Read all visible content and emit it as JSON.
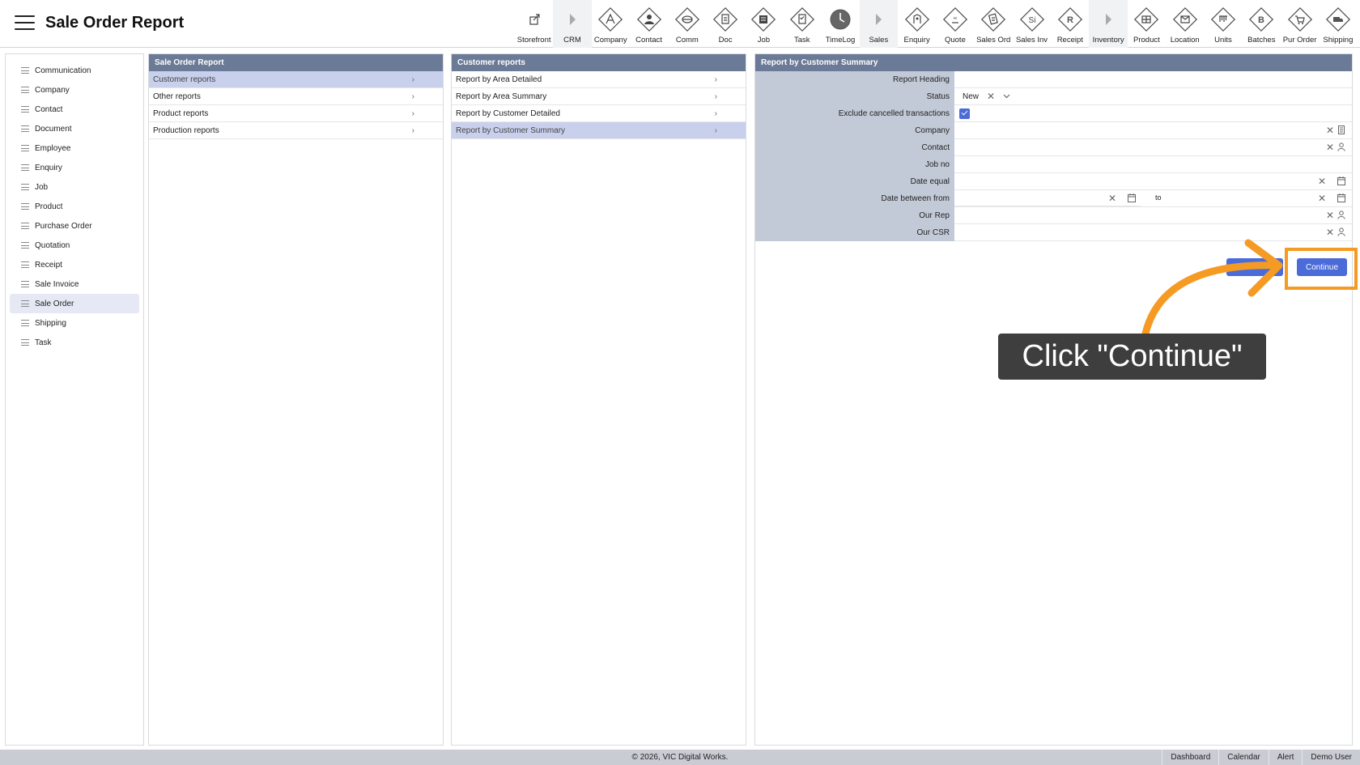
{
  "header": {
    "title": "Sale Order Report"
  },
  "toolbar": [
    {
      "label": "Storefront",
      "icon": "external-link-icon"
    },
    {
      "label": "CRM",
      "icon": "triangle-right-icon"
    },
    {
      "label": "Company",
      "icon": "company-icon"
    },
    {
      "label": "Contact",
      "icon": "contact-icon"
    },
    {
      "label": "Comm",
      "icon": "comm-icon"
    },
    {
      "label": "Doc",
      "icon": "doc-icon"
    },
    {
      "label": "Job",
      "icon": "job-icon"
    },
    {
      "label": "Task",
      "icon": "task-icon"
    },
    {
      "label": "TimeLog",
      "icon": "timelog-icon"
    },
    {
      "label": "Sales",
      "icon": "triangle-right-icon"
    },
    {
      "label": "Enquiry",
      "icon": "enquiry-icon"
    },
    {
      "label": "Quote",
      "icon": "quote-icon"
    },
    {
      "label": "Sales Ord",
      "icon": "sales-order-icon"
    },
    {
      "label": "Sales Inv",
      "icon": "sales-invoice-icon"
    },
    {
      "label": "Receipt",
      "icon": "receipt-icon"
    },
    {
      "label": "Inventory",
      "icon": "triangle-right-icon"
    },
    {
      "label": "Product",
      "icon": "product-icon"
    },
    {
      "label": "Location",
      "icon": "location-icon"
    },
    {
      "label": "Units",
      "icon": "units-icon"
    },
    {
      "label": "Batches",
      "icon": "batches-icon"
    },
    {
      "label": "Pur Order",
      "icon": "purchase-order-icon"
    },
    {
      "label": "Shipping",
      "icon": "shipping-icon"
    }
  ],
  "sidebar": {
    "items": [
      {
        "label": "Communication"
      },
      {
        "label": "Company"
      },
      {
        "label": "Contact"
      },
      {
        "label": "Document"
      },
      {
        "label": "Employee"
      },
      {
        "label": "Enquiry"
      },
      {
        "label": "Job"
      },
      {
        "label": "Product"
      },
      {
        "label": "Purchase Order"
      },
      {
        "label": "Quotation"
      },
      {
        "label": "Receipt"
      },
      {
        "label": "Sale Invoice"
      },
      {
        "label": "Sale Order"
      },
      {
        "label": "Shipping"
      },
      {
        "label": "Task"
      }
    ],
    "active": "Sale Order"
  },
  "panel1": {
    "title": "Sale Order Report",
    "rows": [
      "Customer reports",
      "Other reports",
      "Product reports",
      "Production reports"
    ],
    "selected": "Customer reports"
  },
  "panel2": {
    "title": "Customer reports",
    "rows": [
      "Report by Area Detailed",
      "Report by Area Summary",
      "Report by Customer Detailed",
      "Report by Customer Summary"
    ],
    "selected": "Report by Customer Summary"
  },
  "form": {
    "title": "Report by Customer Summary",
    "labels": {
      "report_heading": "Report Heading",
      "status": "Status",
      "exclude_cancelled": "Exclude cancelled transactions",
      "company": "Company",
      "contact": "Contact",
      "job_no": "Job no",
      "date_equal": "Date equal",
      "date_between": "Date between from",
      "our_rep": "Our Rep",
      "our_csr": "Our CSR"
    },
    "status_value": "New",
    "exclude_cancelled_checked": true,
    "to_label": "to",
    "continue_label": "Continue"
  },
  "tooltip": {
    "text": "Click \"Continue\""
  },
  "accent_colors": {
    "primary": "#4a6bd8",
    "highlight": "#f59a23",
    "panel_header": "#6b7a96"
  },
  "footer": {
    "copyright": "© 2026, VIC Digital Works.",
    "links": [
      "Dashboard",
      "Calendar",
      "Alert",
      "Demo User"
    ]
  }
}
